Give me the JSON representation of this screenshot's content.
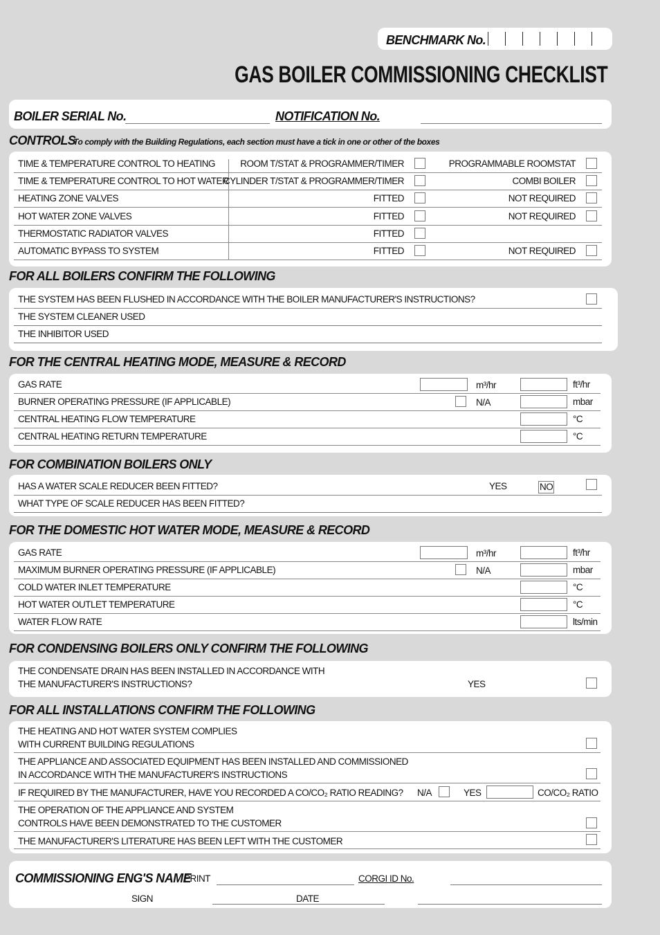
{
  "benchmark": {
    "label": "BENCHMARK No.",
    "slots": 7
  },
  "title": "GAS BOILER COMMISSIONING CHECKLIST",
  "serial": {
    "boiler_serial_label": "BOILER SERIAL No.",
    "boiler_serial_value": "",
    "notification_label": "NOTIFICATION No.",
    "notification_value": ""
  },
  "controls": {
    "heading": "CONTROLS",
    "note": "To comply with the Building Regulations, each section must have a tick in one or other of the boxes",
    "rows": [
      {
        "label": "TIME & TEMPERATURE CONTROL TO HEATING",
        "option1": "ROOM T/STAT & PROGRAMMER/TIMER",
        "option2": "PROGRAMMABLE ROOMSTAT"
      },
      {
        "label": "TIME & TEMPERATURE CONTROL TO HOT WATER",
        "option1": "CYLINDER T/STAT & PROGRAMMER/TIMER",
        "option2": "COMBI BOILER"
      },
      {
        "label": "HEATING ZONE VALVES",
        "option1": "FITTED",
        "option2": "NOT REQUIRED"
      },
      {
        "label": "HOT WATER ZONE VALVES",
        "option1": "FITTED",
        "option2": "NOT REQUIRED"
      },
      {
        "label": "THERMOSTATIC RADIATOR VALVES",
        "option1": "FITTED",
        "option2": null
      },
      {
        "label": "AUTOMATIC BYPASS TO SYSTEM",
        "option1": "FITTED",
        "option2": "NOT REQUIRED"
      }
    ]
  },
  "all_boilers": {
    "heading": "FOR ALL BOILERS CONFIRM THE FOLLOWING",
    "flushed": "THE SYSTEM HAS BEEN FLUSHED IN ACCORDANCE WITH THE BOILER MANUFACTURER'S INSTRUCTIONS?",
    "cleaner": "THE SYSTEM CLEANER USED",
    "inhibitor": "THE INHIBITOR USED"
  },
  "central_heating": {
    "heading": "FOR THE CENTRAL HEATING MODE, MEASURE & RECORD",
    "rows": [
      {
        "label": "GAS RATE",
        "unit1": "m³/hr",
        "unit2": "ft³/hr"
      },
      {
        "label": "BURNER OPERATING PRESSURE (IF APPLICABLE)",
        "na": "N/A",
        "unit2": "mbar"
      },
      {
        "label": "CENTRAL HEATING FLOW TEMPERATURE",
        "unit2": "°C"
      },
      {
        "label": "CENTRAL HEATING RETURN TEMPERATURE",
        "unit2": "°C"
      }
    ]
  },
  "combination": {
    "heading": "FOR COMBINATION BOILERS ONLY",
    "scale_reducer": "HAS A WATER SCALE REDUCER BEEN FITTED?",
    "yes": "YES",
    "no": "NO",
    "scale_type": "WHAT TYPE OF SCALE REDUCER HAS BEEN FITTED?"
  },
  "dhw": {
    "heading": "FOR THE DOMESTIC HOT WATER MODE, MEASURE & RECORD",
    "rows": [
      {
        "label": "GAS RATE",
        "unit1": "m³/hr",
        "unit2": "ft³/hr"
      },
      {
        "label": "MAXIMUM BURNER OPERATING PRESSURE (IF APPLICABLE)",
        "na": "N/A",
        "unit2": "mbar"
      },
      {
        "label": "COLD WATER INLET TEMPERATURE",
        "unit2": "°C"
      },
      {
        "label": "HOT WATER OUTLET TEMPERATURE",
        "unit2": "°C"
      },
      {
        "label": "WATER FLOW RATE",
        "unit2": "lts/min"
      }
    ]
  },
  "condensing": {
    "heading": "FOR CONDENSING BOILERS ONLY CONFIRM THE FOLLOWING",
    "line1": "THE CONDENSATE DRAIN HAS BEEN INSTALLED IN ACCORDANCE WITH",
    "line2": "THE MANUFACTURER'S INSTRUCTIONS?",
    "yes": "YES"
  },
  "installations": {
    "heading": "FOR ALL INSTALLATIONS CONFIRM THE FOLLOWING",
    "regs1": "THE HEATING AND HOT WATER SYSTEM COMPLIES",
    "regs2": "WITH CURRENT BUILDING REGULATIONS",
    "appliance1": "THE APPLIANCE AND ASSOCIATED EQUIPMENT HAS BEEN INSTALLED AND COMMISSIONED",
    "appliance2": "IN ACCORDANCE WITH THE MANUFACTURER'S INSTRUCTIONS",
    "co_question": "IF REQUIRED BY THE MANUFACTURER, HAVE YOU RECORDED A CO/CO₂ RATIO READING?",
    "na": "N/A",
    "yes": "YES",
    "co_ratio": "CO/CO₂ RATIO",
    "demo1": "THE OPERATION OF THE APPLIANCE AND SYSTEM",
    "demo2": "CONTROLS HAVE BEEN DEMONSTRATED TO THE CUSTOMER",
    "literature": "THE MANUFACTURER'S LITERATURE HAS BEEN LEFT WITH THE CUSTOMER"
  },
  "engineer": {
    "heading": "COMMISSIONING ENG'S NAME",
    "print": "PRINT",
    "corgi": "CORGI ID No.",
    "sign": "SIGN",
    "date": "DATE"
  }
}
